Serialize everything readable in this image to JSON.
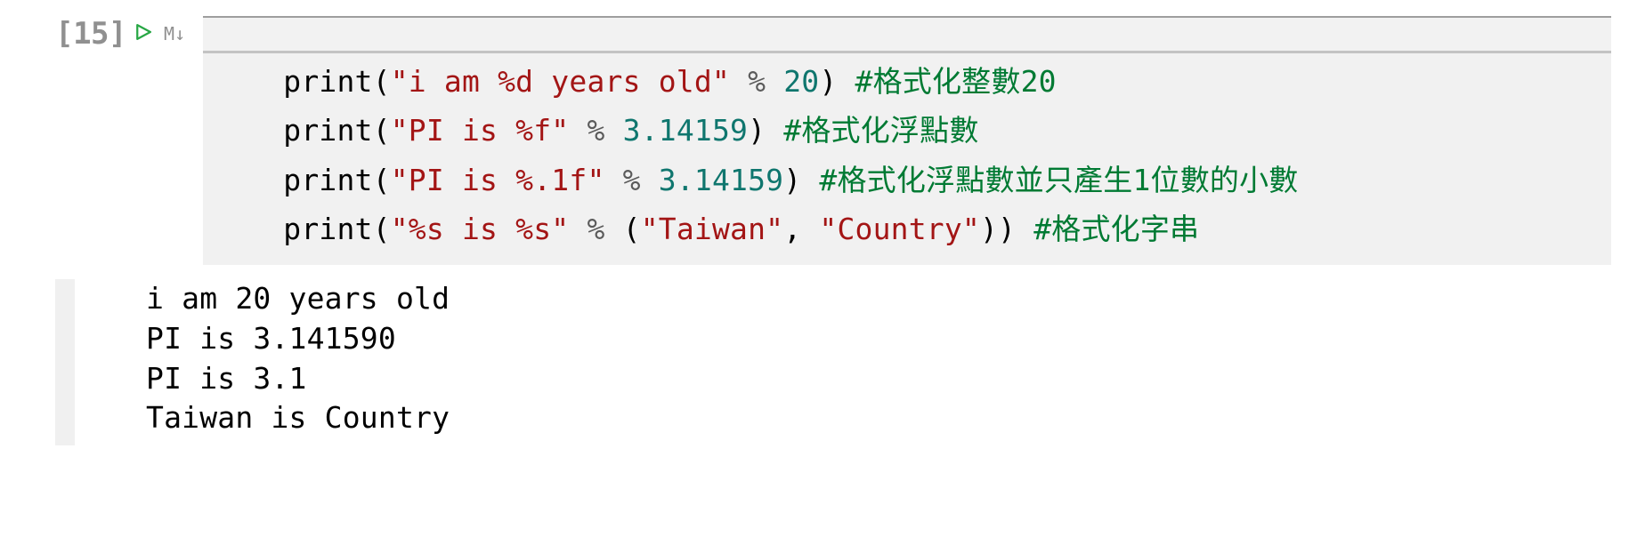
{
  "cell": {
    "prompt": "[15]",
    "md_button": "M↓",
    "code_lines": [
      {
        "indent": "    ",
        "parts": [
          {
            "cls": "tok-fn",
            "t": "print"
          },
          {
            "cls": "tok-p",
            "t": "("
          },
          {
            "cls": "tok-str",
            "t": "\"i am %d years old\""
          },
          {
            "cls": "tok-p",
            "t": " "
          },
          {
            "cls": "tok-op",
            "t": "%"
          },
          {
            "cls": "tok-p",
            "t": " "
          },
          {
            "cls": "tok-num",
            "t": "20"
          },
          {
            "cls": "tok-p",
            "t": ") "
          },
          {
            "cls": "tok-cmt",
            "t": "#格式化整數20"
          }
        ]
      },
      {
        "indent": "    ",
        "parts": [
          {
            "cls": "tok-fn",
            "t": "print"
          },
          {
            "cls": "tok-p",
            "t": "("
          },
          {
            "cls": "tok-str",
            "t": "\"PI is %f\""
          },
          {
            "cls": "tok-p",
            "t": " "
          },
          {
            "cls": "tok-op",
            "t": "%"
          },
          {
            "cls": "tok-p",
            "t": " "
          },
          {
            "cls": "tok-num",
            "t": "3.14159"
          },
          {
            "cls": "tok-p",
            "t": ") "
          },
          {
            "cls": "tok-cmt",
            "t": "#格式化浮點數"
          }
        ]
      },
      {
        "indent": "    ",
        "parts": [
          {
            "cls": "tok-fn",
            "t": "print"
          },
          {
            "cls": "tok-p",
            "t": "("
          },
          {
            "cls": "tok-str",
            "t": "\"PI is %.1f\""
          },
          {
            "cls": "tok-p",
            "t": " "
          },
          {
            "cls": "tok-op",
            "t": "%"
          },
          {
            "cls": "tok-p",
            "t": " "
          },
          {
            "cls": "tok-num",
            "t": "3.14159"
          },
          {
            "cls": "tok-p",
            "t": ") "
          },
          {
            "cls": "tok-cmt",
            "t": "#格式化浮點數並只產生1位數的小數"
          }
        ]
      },
      {
        "indent": "    ",
        "parts": [
          {
            "cls": "tok-fn",
            "t": "print"
          },
          {
            "cls": "tok-p",
            "t": "("
          },
          {
            "cls": "tok-str",
            "t": "\"%s is %s\""
          },
          {
            "cls": "tok-p",
            "t": " "
          },
          {
            "cls": "tok-op",
            "t": "%"
          },
          {
            "cls": "tok-p",
            "t": " ("
          },
          {
            "cls": "tok-str",
            "t": "\"Taiwan\""
          },
          {
            "cls": "tok-p",
            "t": ", "
          },
          {
            "cls": "tok-str",
            "t": "\"Country\""
          },
          {
            "cls": "tok-p",
            "t": ")) "
          },
          {
            "cls": "tok-cmt",
            "t": "#格式化字串"
          }
        ]
      }
    ],
    "output": "i am 20 years old\nPI is 3.141590\nPI is 3.1\nTaiwan is Country"
  }
}
